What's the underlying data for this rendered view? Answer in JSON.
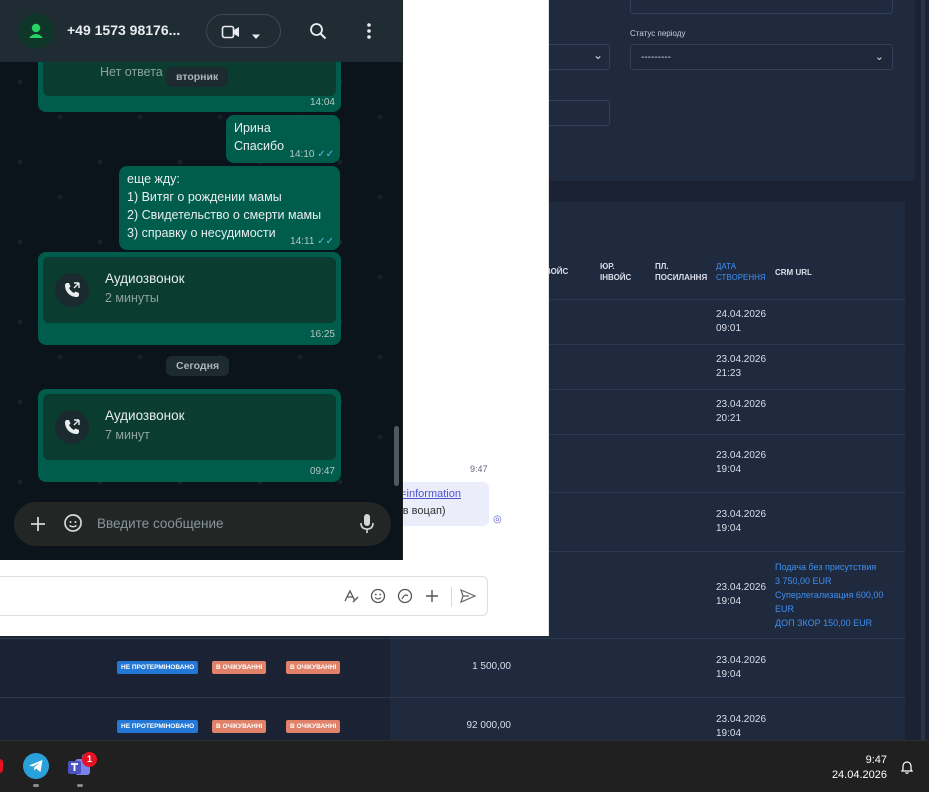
{
  "crm": {
    "filter": {
      "period_status_label": "Статус періоду",
      "period_status_value": "---------"
    },
    "table": {
      "headers": {
        "invoice": "ВОЙС",
        "legal_invoice": "ЮР. ІНВОЙС",
        "payment_link": "ПЛ. ПОСИЛАННЯ",
        "created_date": "ДАТА СТВОРЕННЯ",
        "crm_url": "CRM URL"
      },
      "rows": [
        {
          "date": "24.04.2026",
          "time": "09:01"
        },
        {
          "date": "23.04.2026",
          "time": "21:23"
        },
        {
          "date": "23.04.2026",
          "time": "20:21"
        },
        {
          "date": "23.04.2026",
          "time": "19:04"
        },
        {
          "date": "23.04.2026",
          "time": "19:04"
        },
        {
          "date": "23.04.2026",
          "time": "19:04",
          "links": [
            "Подача без присутствия",
            "3 750,00 EUR",
            "Суперлегализация 600,00",
            "EUR",
            "ДОП ЗКОР 150,00 EUR"
          ]
        },
        {
          "date": "23.04.2026",
          "time": "19:04",
          "badges": [
            "НЕ ПРОТЕРМІНОВАНО",
            "В ОЧІКУВАННІ",
            "В ОЧІКУВАННІ"
          ],
          "amount": "1 500,00"
        },
        {
          "date": "23.04.2026",
          "time": "19:04",
          "badges": [
            "НЕ ПРОТЕРМІНОВАНО",
            "В ОЧІКУВАННІ",
            "В ОЧІКУВАННІ"
          ],
          "amount": "92 000,00"
        }
      ]
    }
  },
  "chat_panel": {
    "time": "9:47",
    "message_line1": "o=information",
    "message_line2": "ь в воцап)"
  },
  "whatsapp": {
    "contact_name": "+49 1573 98176...",
    "messages": [
      {
        "type": "call",
        "sub": "Нет ответа",
        "time": "14:04"
      },
      {
        "type": "text",
        "lines": [
          "Ирина",
          "Спасибо"
        ],
        "time": "14:10"
      },
      {
        "type": "text",
        "lines": [
          "еще жду:",
          "1) Витяг о рождении мамы",
          "2) Свидетельство о смерти мамы",
          "3) справку о несудимости"
        ],
        "time": "14:11"
      },
      {
        "type": "call",
        "title": "Аудиозвонок",
        "sub": "2 минуты",
        "time": "16:25"
      },
      {
        "type": "call",
        "title": "Аудиозвонок",
        "sub": "7 минут",
        "time": "09:47"
      }
    ],
    "day_chips": {
      "tuesday": "вторник",
      "today": "Сегодня"
    },
    "input_placeholder": "Введите сообщение"
  },
  "taskbar": {
    "time": "9:47",
    "date": "24.04.2026",
    "teams_badge": "1",
    "icons": [
      "telegram-icon",
      "teams-icon",
      "notification-icon"
    ]
  },
  "colors": {
    "crm_bg": "#1b2233",
    "crm_accent": "#3d8ff2",
    "wa_bubble": "#005c4b",
    "wa_bg": "#0b141a"
  }
}
